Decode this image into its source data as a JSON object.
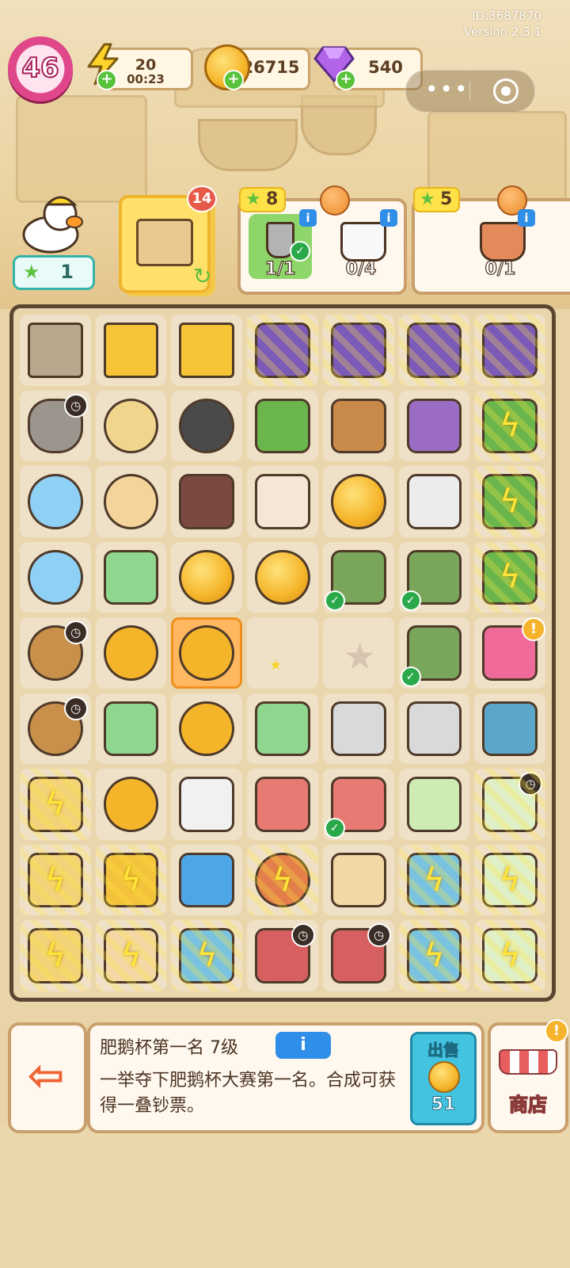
{
  "meta": {
    "id_text": "ID:3687870",
    "version_text": "Version 2.3.1"
  },
  "player": {
    "level": "46"
  },
  "resources": {
    "energy": {
      "value": "20",
      "timer": "00:23",
      "icon": "lightning-bolt-icon"
    },
    "coins": {
      "value": "26715",
      "icon": "coin-icon"
    },
    "gems": {
      "value": "540",
      "icon": "purple-gem-icon"
    }
  },
  "miniprogram_capsule": {
    "more": "•••",
    "close_icon": "target-circle-icon"
  },
  "character": {
    "stars": "1"
  },
  "generator_box": {
    "count": "14"
  },
  "orders": [
    {
      "reward": "8",
      "items": [
        {
          "name": "shovel",
          "progress": "1/1",
          "done": true
        },
        {
          "name": "paint-bucket",
          "progress": "0/4",
          "done": false
        }
      ]
    },
    {
      "reward": "5",
      "items": [
        {
          "name": "flower-pot",
          "progress": "0/1",
          "done": false
        }
      ]
    }
  ],
  "board": {
    "rows": [
      [
        {
          "t": "cab"
        },
        {
          "t": "yellow"
        },
        {
          "t": "yellow"
        },
        {
          "t": "purple",
          "w": 1
        },
        {
          "t": "purple",
          "w": 1
        },
        {
          "t": "purple",
          "w": 1
        },
        {
          "t": "purple",
          "w": 1
        }
      ],
      [
        {
          "t": "sack",
          "clock": 1
        },
        {
          "t": "snail"
        },
        {
          "t": "dark"
        },
        {
          "t": "green"
        },
        {
          "t": "brown"
        },
        {
          "t": "book"
        },
        {
          "t": "green",
          "w": 1,
          "bolt": 1
        }
      ],
      [
        {
          "t": "blue"
        },
        {
          "t": "mouse"
        },
        {
          "t": "case"
        },
        {
          "t": "can"
        },
        {
          "t": "coin"
        },
        {
          "t": "roller"
        },
        {
          "t": "green",
          "w": 1,
          "bolt": 1
        }
      ],
      [
        {
          "t": "blue"
        },
        {
          "t": "money"
        },
        {
          "t": "coin"
        },
        {
          "t": "coin"
        },
        {
          "t": "glove",
          "check": 1
        },
        {
          "t": "glove",
          "check": 1
        },
        {
          "t": "green",
          "w": 1,
          "bolt": 1
        }
      ],
      [
        {
          "t": "basket",
          "clock": 1
        },
        {
          "t": "medal"
        },
        {
          "t": "medal",
          "sel": 1
        },
        {
          "t": "empty",
          "sparkle": 1
        },
        {
          "t": "star"
        },
        {
          "t": "glove",
          "check": 1
        },
        {
          "t": "pink",
          "bang": 1
        }
      ],
      [
        {
          "t": "basket",
          "clock": 1
        },
        {
          "t": "money"
        },
        {
          "t": "medal"
        },
        {
          "t": "money"
        },
        {
          "t": "grip"
        },
        {
          "t": "grip"
        },
        {
          "t": "bench"
        }
      ],
      [
        {
          "t": "cup",
          "w": 1,
          "bolt": 1
        },
        {
          "t": "medal"
        },
        {
          "t": "box"
        },
        {
          "t": "shovel"
        },
        {
          "t": "shovel",
          "check": 1
        },
        {
          "t": "seed"
        },
        {
          "t": "laptop",
          "w": 1,
          "clock": 1
        }
      ],
      [
        {
          "t": "cup",
          "w": 1,
          "bolt": 1
        },
        {
          "t": "cart",
          "w": 1,
          "bolt": 1
        },
        {
          "t": "cpu"
        },
        {
          "t": "hand",
          "w": 1,
          "bolt": 1
        },
        {
          "t": "toy"
        },
        {
          "t": "cart3",
          "w": 1,
          "bolt": 1
        },
        {
          "t": "laptop",
          "w": 1,
          "bolt": 1
        }
      ],
      [
        {
          "t": "cup",
          "w": 1,
          "bolt": 1
        },
        {
          "t": "toy",
          "w": 1,
          "bolt": 1
        },
        {
          "t": "cart3",
          "w": 1,
          "bolt": 1
        },
        {
          "t": "cart2",
          "clock": 1
        },
        {
          "t": "cart2",
          "clock": 1
        },
        {
          "t": "cart3",
          "w": 1,
          "bolt": 1
        },
        {
          "t": "laptop",
          "w": 1,
          "bolt": 1
        }
      ]
    ]
  },
  "selected_item": {
    "title": "肥鹅杯第一名 7级",
    "info_label": "i",
    "description": "一举夺下肥鹅杯大赛第一名。合成可获得一叠钞票。",
    "sell_label": "出售",
    "sell_price": "51"
  },
  "nav": {
    "exit_icon": "exit-door-icon",
    "shop_label": "商店"
  }
}
